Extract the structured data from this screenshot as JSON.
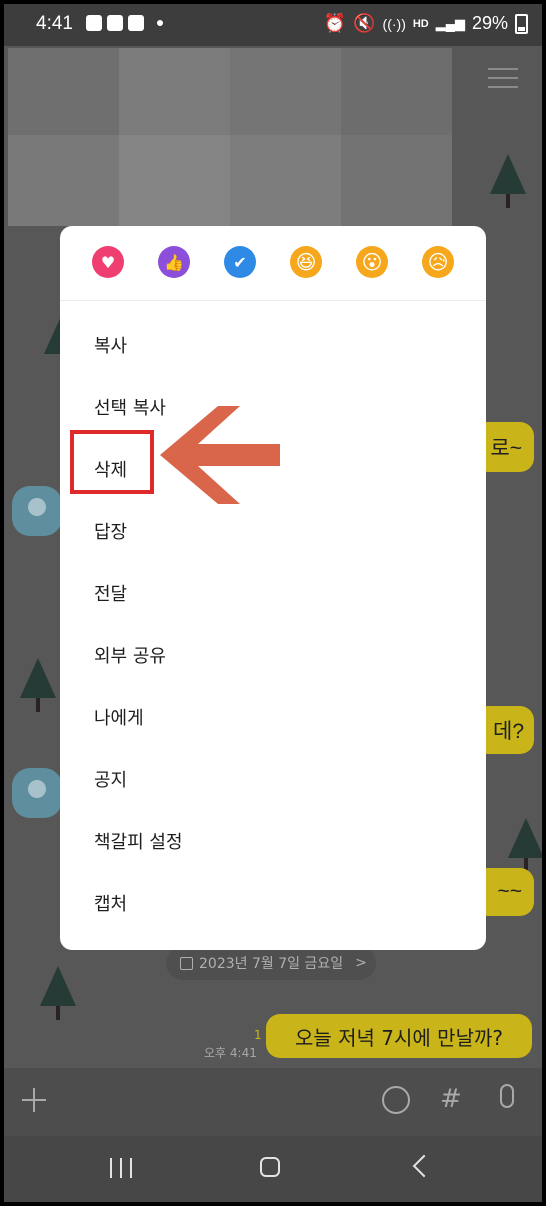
{
  "status_bar": {
    "time": "4:41",
    "network_label": "HD",
    "battery": "29%"
  },
  "chat": {
    "bubbles_partial": [
      "로~",
      "데?",
      "~~"
    ],
    "date_separator": "2023년 7월 7일 금요일",
    "date_chevron": ">",
    "unread_count": "1",
    "message_time": "오후 4:41",
    "last_message": "오늘 저녁 7시에 만날까?"
  },
  "reactions": [
    "heart-icon",
    "thumbs-up-icon",
    "check-icon",
    "grinning-face-icon",
    "surprised-face-icon",
    "sad-face-icon"
  ],
  "context_menu": {
    "items": [
      "복사",
      "선택 복사",
      "삭제",
      "답장",
      "전달",
      "외부 공유",
      "나에게",
      "공지",
      "책갈피 설정",
      "캡처"
    ],
    "highlighted_item": "삭제"
  },
  "input_bar": {
    "hash_symbol": "#"
  },
  "colors": {
    "bubble": "#c9b51a",
    "highlight": "#de2a2a",
    "arrow": "#d9664a",
    "heart": "#ef3f71",
    "thumbs": "#8c4fd9",
    "check": "#2f8ae6"
  }
}
